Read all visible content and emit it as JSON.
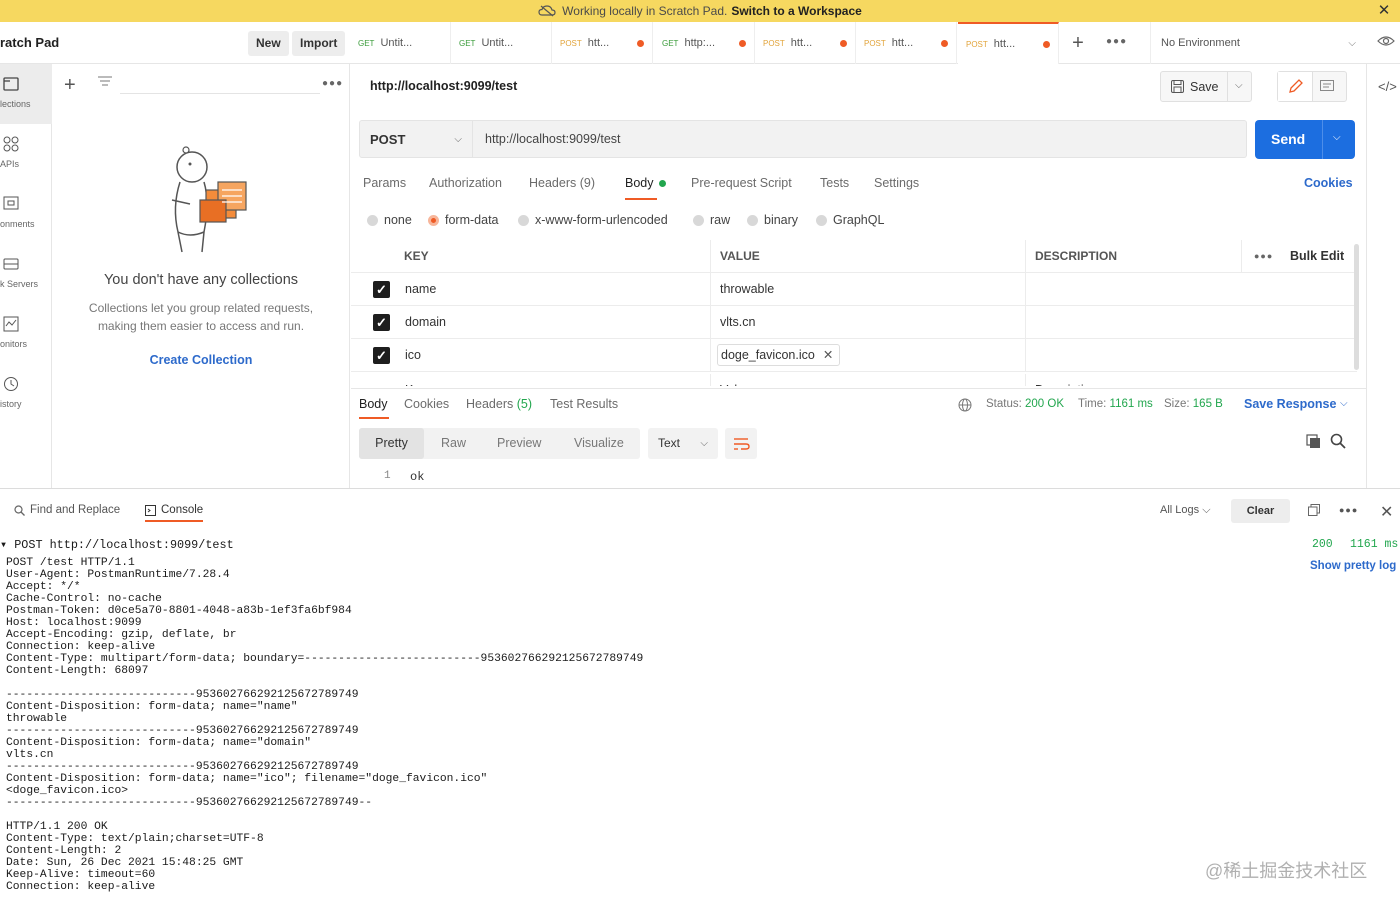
{
  "banner": {
    "text": "Working locally in Scratch Pad.",
    "link": "Switch to a Workspace"
  },
  "header": {
    "workspace": "ratch Pad",
    "new_label": "New",
    "import_label": "Import",
    "tabs": [
      {
        "method": "GET",
        "label": "Untit...",
        "dot": false
      },
      {
        "method": "GET",
        "label": "Untit...",
        "dot": false
      },
      {
        "method": "POST",
        "label": "htt...",
        "dot": true
      },
      {
        "method": "GET",
        "label": "http:...",
        "dot": true
      },
      {
        "method": "POST",
        "label": "htt...",
        "dot": true
      },
      {
        "method": "POST",
        "label": "htt...",
        "dot": true
      },
      {
        "method": "POST",
        "label": "htt...",
        "dot": true
      }
    ],
    "environment": "No Environment"
  },
  "rail": {
    "items": [
      {
        "label": "lections",
        "icon": "collections-icon"
      },
      {
        "label": "APIs",
        "icon": "apis-icon"
      },
      {
        "label": "onments",
        "icon": "environments-icon"
      },
      {
        "label": "k Servers",
        "icon": "mock-servers-icon"
      },
      {
        "label": "onitors",
        "icon": "monitors-icon"
      },
      {
        "label": "istory",
        "icon": "history-icon"
      }
    ]
  },
  "sidebar": {
    "empty_title": "You don't have any collections",
    "empty_text": "Collections let you group related requests, making them easier to access and run.",
    "create_label": "Create Collection"
  },
  "request": {
    "title": "http://localhost:9099/test",
    "save_label": "Save",
    "method": "POST",
    "url": "http://localhost:9099/test",
    "send_label": "Send",
    "tabs": [
      "Params",
      "Authorization",
      "Headers",
      "Body",
      "Pre-request Script",
      "Tests",
      "Settings"
    ],
    "headers_count": "(9)",
    "cookies_label": "Cookies",
    "body_types": [
      "none",
      "form-data",
      "x-www-form-urlencoded",
      "raw",
      "binary",
      "GraphQL"
    ],
    "selected_body_type": "form-data"
  },
  "params": {
    "col_key": "KEY",
    "col_value": "VALUE",
    "col_desc": "DESCRIPTION",
    "bulk_edit": "Bulk Edit",
    "rows": [
      {
        "key": "name",
        "value": "throwable"
      },
      {
        "key": "domain",
        "value": "vlts.cn"
      },
      {
        "key": "ico",
        "value": "doge_favicon.ico"
      }
    ],
    "placeholder_key": "Key",
    "placeholder_value": "Value",
    "placeholder_desc": "Description"
  },
  "response": {
    "tabs": [
      "Body",
      "Cookies",
      "Headers",
      "Test Results"
    ],
    "headers_count": "(5)",
    "status_label": "Status:",
    "status_value": "200 OK",
    "time_label": "Time:",
    "time_value": "1161 ms",
    "size_label": "Size:",
    "size_value": "165 B",
    "save_response": "Save Response",
    "formats": [
      "Pretty",
      "Raw",
      "Preview",
      "Visualize"
    ],
    "text_type": "Text",
    "line_no": "1",
    "body_line": "ok"
  },
  "console": {
    "find_replace": "Find and Replace",
    "console_label": "Console",
    "all_logs": "All Logs",
    "clear_label": "Clear",
    "first_line": "POST http://localhost:9099/test",
    "status": "200",
    "time": "1161 ms",
    "show_pretty": "Show pretty log",
    "log": "POST /test HTTP/1.1\nUser-Agent: PostmanRuntime/7.28.4\nAccept: */*\nCache-Control: no-cache\nPostman-Token: d0ce5a70-8801-4048-a83b-1ef3fa6bf984\nHost: localhost:9099\nAccept-Encoding: gzip, deflate, br\nConnection: keep-alive\nContent-Type: multipart/form-data; boundary=--------------------------953602766292125672789749\nContent-Length: 68097\n\n----------------------------953602766292125672789749\nContent-Disposition: form-data; name=\"name\"\nthrowable\n----------------------------953602766292125672789749\nContent-Disposition: form-data; name=\"domain\"\nvlts.cn\n----------------------------953602766292125672789749\nContent-Disposition: form-data; name=\"ico\"; filename=\"doge_favicon.ico\"\n<doge_favicon.ico>\n----------------------------953602766292125672789749--\n\nHTTP/1.1 200 OK\nContent-Type: text/plain;charset=UTF-8\nContent-Length: 2\nDate: Sun, 26 Dec 2021 15:48:25 GMT\nKeep-Alive: timeout=60\nConnection: keep-alive"
  },
  "watermark": "@稀土掘金技术社区",
  "colors": {
    "accent": "#ef5b25",
    "send": "#1c6ee0",
    "link": "#2d6acb",
    "success": "#22a64e",
    "banner": "#f6d860"
  }
}
